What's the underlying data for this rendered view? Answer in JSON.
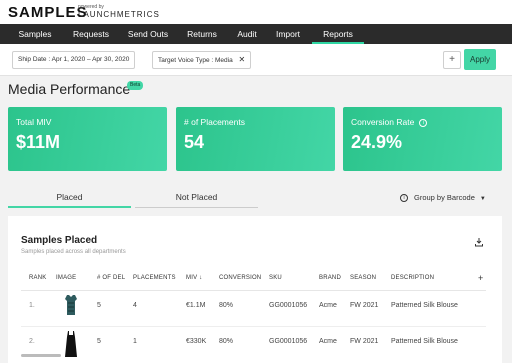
{
  "app": {
    "logo": "SAMPLES",
    "logo_sub": "powered by",
    "logo_brand": "LAUNCHMETRICS"
  },
  "nav": {
    "items": [
      {
        "label": "Samples"
      },
      {
        "label": "Requests"
      },
      {
        "label": "Send Outs"
      },
      {
        "label": "Returns"
      },
      {
        "label": "Audit"
      },
      {
        "label": "Import"
      },
      {
        "label": "Reports"
      }
    ],
    "active": "Reports"
  },
  "filters": {
    "ship_date": {
      "label": "Ship Date :",
      "value": "Apr 1, 2020 – Apr 30, 2020"
    },
    "target_voice": {
      "label": "Target Voice Type :",
      "value": "Media"
    },
    "plus_label": "+",
    "apply_label": "Apply"
  },
  "page": {
    "title": "Media Performance",
    "badge": "Beta"
  },
  "metrics": [
    {
      "label": "Total MIV",
      "value": "$11M"
    },
    {
      "label": "# of Placements",
      "value": "54"
    },
    {
      "label": "Conversion Rate",
      "value": "24.9%"
    }
  ],
  "tabs": [
    {
      "label": "Placed"
    },
    {
      "label": "Not Placed"
    }
  ],
  "groupby": {
    "label": "Group by Barcode"
  },
  "panel": {
    "title": "Samples Placed",
    "subtitle": "Samples placed across all departments"
  },
  "table": {
    "headers": [
      "RANK",
      "IMAGE",
      "# OF DEL",
      "PLACEMENTS",
      "MIV",
      "CONVERSION",
      "SKU",
      "BRAND",
      "SEASON",
      "DESCRIPTION"
    ],
    "miv_sort": "↓",
    "add_column": "+",
    "rows": [
      {
        "rank": "1.",
        "del": "5",
        "placements": "4",
        "miv": "€1.1M",
        "conversion": "80%",
        "sku": "GG0001056",
        "brand": "Acme",
        "season": "FW 2021",
        "description": "Patterned Silk Blouse"
      },
      {
        "rank": "2.",
        "del": "5",
        "placements": "1",
        "miv": "€330K",
        "conversion": "80%",
        "sku": "GG0001056",
        "brand": "Acme",
        "season": "FW 2021",
        "description": "Patterned Silk Blouse"
      }
    ]
  },
  "colors": {
    "accent": "#43d6a6",
    "nav_bg": "#2b2b2b"
  }
}
